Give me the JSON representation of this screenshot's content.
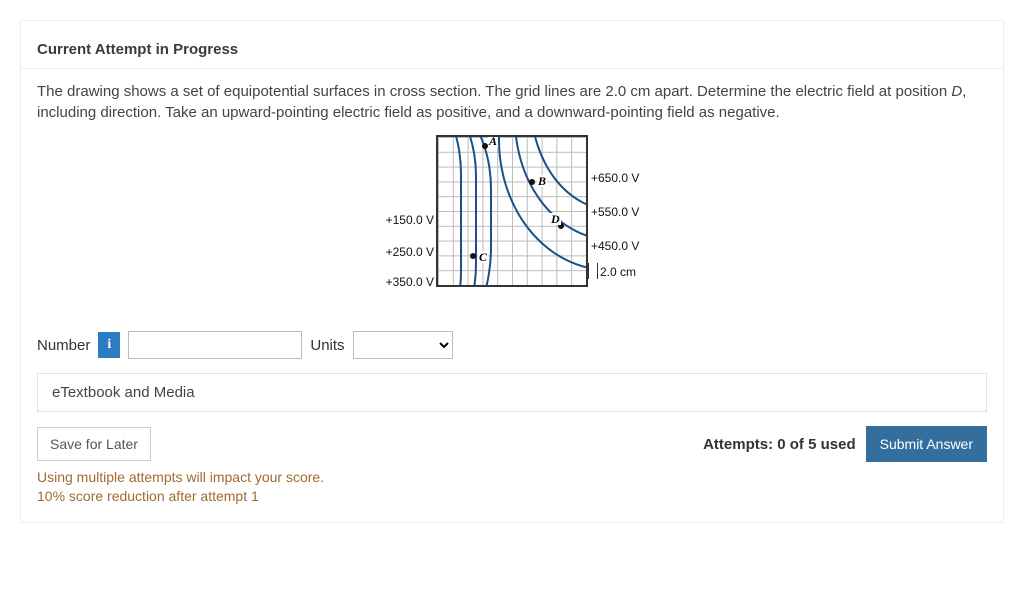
{
  "heading": "Current Attempt in Progress",
  "prompt_pre": "The drawing shows a set of equipotential surfaces in cross section. The grid lines are 2.0 cm apart. Determine the electric field at position ",
  "prompt_point": "D",
  "prompt_post": ", including direction. Take an upward-pointing electric field as positive, and a downward-pointing field as negative.",
  "figure": {
    "left_labels": {
      "v150": "+150.0 V",
      "v250": "+250.0 V",
      "v350": "+350.0 V"
    },
    "right_labels": {
      "v650": "+650.0 V",
      "v550": "+550.0 V",
      "v450": "+450.0 V"
    },
    "scale": "2.0 cm",
    "points": {
      "A": "A",
      "B": "B",
      "C": "C",
      "D": "D"
    }
  },
  "answer": {
    "number_label": "Number",
    "info_glyph": "i",
    "number_value": "",
    "units_label": "Units",
    "units_selected": ""
  },
  "etextbook": "eTextbook and Media",
  "save_label": "Save for Later",
  "attempts_text": "Attempts: 0 of 5 used",
  "submit_label": "Submit Answer",
  "note_line1": "Using multiple attempts will impact your score.",
  "note_line2": "10% score reduction after attempt 1"
}
